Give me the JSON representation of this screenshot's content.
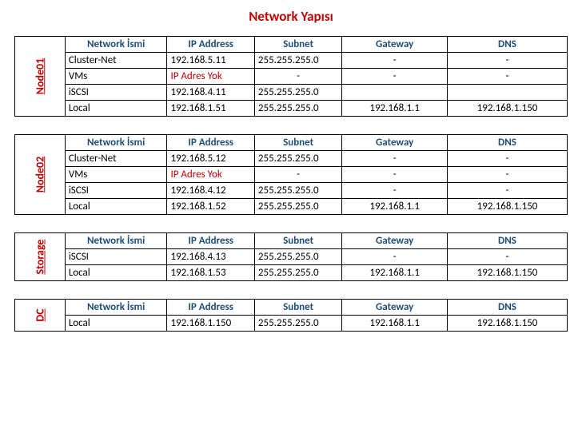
{
  "title": "Network Yapısı",
  "columns": {
    "name": "Network İsmi",
    "ip": "IP Address",
    "subnet": "Subnet",
    "gateway": "Gateway",
    "dns": "DNS"
  },
  "no_ip_text": "IP Adres Yok",
  "dash": "-",
  "sections": [
    {
      "label": "Node01",
      "rows": [
        {
          "name": "Cluster-Net",
          "ip": "192.168.5.11",
          "subnet": "255.255.255.0",
          "gateway": "-",
          "dns": "-"
        },
        {
          "name": "VMs",
          "ip_missing": true,
          "subnet": "-",
          "gateway": "-",
          "dns": "-"
        },
        {
          "name": "iSCSI",
          "ip": "192.168.4.11",
          "subnet": "255.255.255.0",
          "gateway": "",
          "dns": ""
        },
        {
          "name": "Local",
          "ip": "192.168.1.51",
          "subnet": "255.255.255.0",
          "gateway": "192.168.1.1",
          "dns": "192.168.1.150"
        }
      ]
    },
    {
      "label": "Node02",
      "rows": [
        {
          "name": "Cluster-Net",
          "ip": "192.168.5.12",
          "subnet": "255.255.255.0",
          "gateway": "-",
          "dns": "-"
        },
        {
          "name": "VMs",
          "ip_missing": true,
          "subnet": "-",
          "gateway": "-",
          "dns": "-"
        },
        {
          "name": "iSCSI",
          "ip": "192.168.4.12",
          "subnet": "255.255.255.0",
          "gateway": "-",
          "dns": "-"
        },
        {
          "name": "Local",
          "ip": "192.168.1.52",
          "subnet": "255.255.255.0",
          "gateway": "192.168.1.1",
          "dns": "192.168.1.150"
        }
      ]
    },
    {
      "label": "Storage",
      "rows": [
        {
          "name": "iSCSI",
          "ip": "192.168.4.13",
          "subnet": "255.255.255.0",
          "gateway": "-",
          "dns": "-"
        },
        {
          "name": "Local",
          "ip": "192.168.1.53",
          "subnet": "255.255.255.0",
          "gateway": "192.168.1.1",
          "dns": "192.168.1.150"
        }
      ]
    },
    {
      "label": "DC",
      "rows": [
        {
          "name": "Local",
          "ip": "192.168.1.150",
          "subnet": "255.255.255.0",
          "gateway": "192.168.1.1",
          "dns": "192.168.1.150"
        }
      ]
    }
  ]
}
